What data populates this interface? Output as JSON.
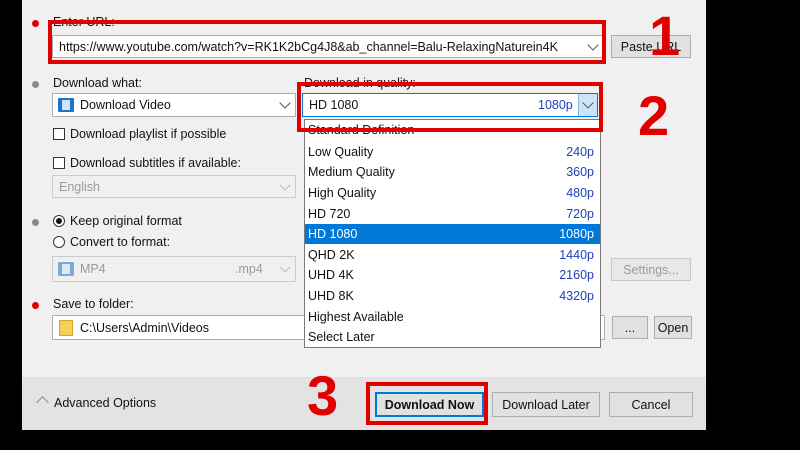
{
  "url_section": {
    "label": "Enter URL:",
    "value": "https://www.youtube.com/watch?v=RK1K2bCg4J8&ab_channel=Balu-RelaxingNaturein4K",
    "paste_button": "Paste URL"
  },
  "download_what": {
    "label": "Download what:",
    "value": "Download Video",
    "playlist_checkbox": "Download playlist if possible",
    "subtitles_checkbox": "Download subtitles if available:",
    "subtitles_language": "English"
  },
  "quality": {
    "label": "Download in quality:",
    "selected_name": "HD 1080",
    "selected_res": "1080p",
    "header": "Standard Definition",
    "options": [
      {
        "name": "Low Quality",
        "res": "240p"
      },
      {
        "name": "Medium Quality",
        "res": "360p"
      },
      {
        "name": "High Quality",
        "res": "480p"
      },
      {
        "name": "HD 720",
        "res": "720p"
      },
      {
        "name": "HD 1080",
        "res": "1080p"
      },
      {
        "name": "QHD 2K",
        "res": "1440p"
      },
      {
        "name": "UHD 4K",
        "res": "2160p"
      },
      {
        "name": "UHD 8K",
        "res": "4320p"
      },
      {
        "name": "Highest Available",
        "res": ""
      },
      {
        "name": "Select Later",
        "res": ""
      }
    ],
    "selected_index": 4
  },
  "format": {
    "keep_original": "Keep original format",
    "convert_to": "Convert to format:",
    "format_name": "MP4",
    "format_ext": ".mp4",
    "settings_button": "Settings..."
  },
  "save": {
    "label": "Save to folder:",
    "path": "C:\\Users\\Admin\\Videos",
    "browse_button": "...",
    "open_button": "Open"
  },
  "footer": {
    "advanced": "Advanced Options",
    "download_now": "Download Now",
    "download_later": "Download Later",
    "cancel": "Cancel"
  },
  "annotations": {
    "step1": "1",
    "step2": "2",
    "step3": "3"
  },
  "colors": {
    "annotation_red": "#e00000",
    "selection_blue": "#0078d7",
    "resolution_blue": "#1d3fbf"
  }
}
